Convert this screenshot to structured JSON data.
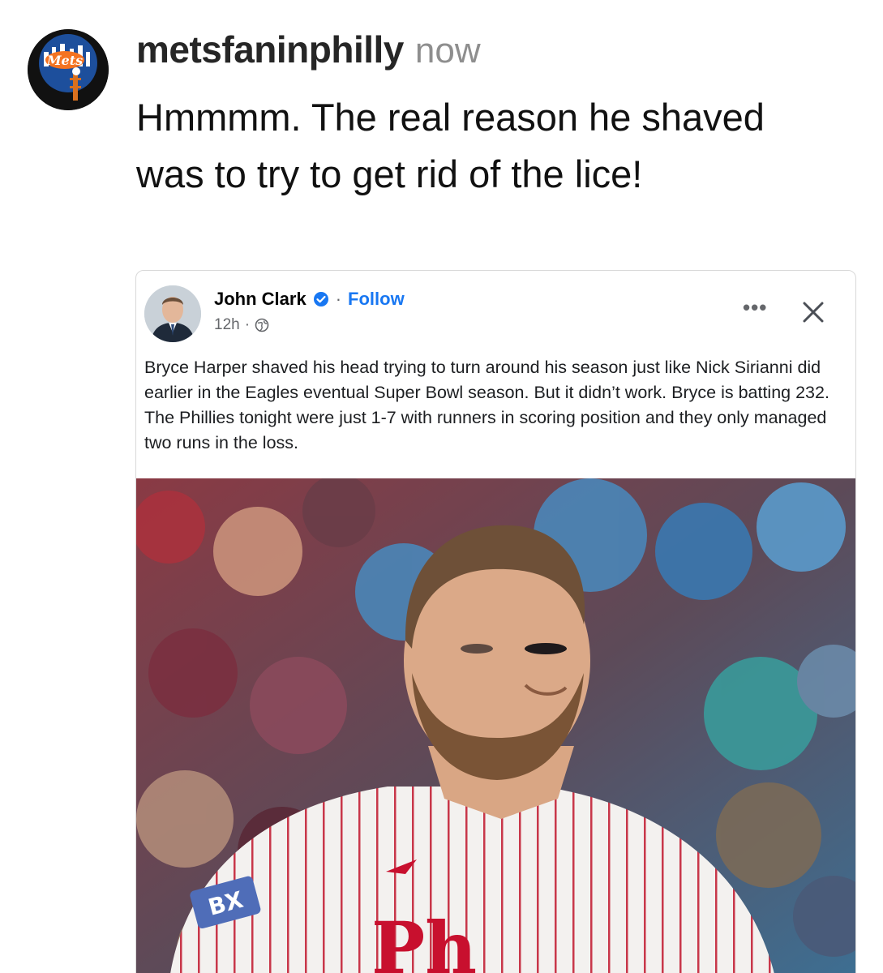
{
  "post": {
    "username": "metsfaninphilly",
    "timestamp": "now",
    "caption": "Hmmmm. The real reason he shaved was to try to get rid of the lice!",
    "avatar_icon": "mets-logo-avatar"
  },
  "embedded_post": {
    "author": "John Clark",
    "separator": "·",
    "follow_label": "Follow",
    "time": "12h",
    "meta_separator": "·",
    "more_label": "•••",
    "text": "Bryce Harper shaved his head trying to turn around his season just like Nick Sirianni did earlier in the Eagles eventual Super Bowl season. But it didn’t work. Bryce is batting 232. The Phillies tonight were just 1-7 with runners in scoring position and they only managed two runs in the loss.",
    "icons": {
      "verified": "verified-badge-icon",
      "globe": "globe-icon",
      "close": "close-icon"
    }
  },
  "photo": {
    "patch_text": "BX",
    "jersey_text": "Ph",
    "colors": {
      "jersey_stripe": "#c8374a",
      "crowd_red": "#a8323d",
      "crowd_blue": "#4a86b8"
    }
  },
  "colors": {
    "link_blue": "#1877f2",
    "text_dark": "#111111",
    "muted_gray": "#8e8e8e"
  }
}
